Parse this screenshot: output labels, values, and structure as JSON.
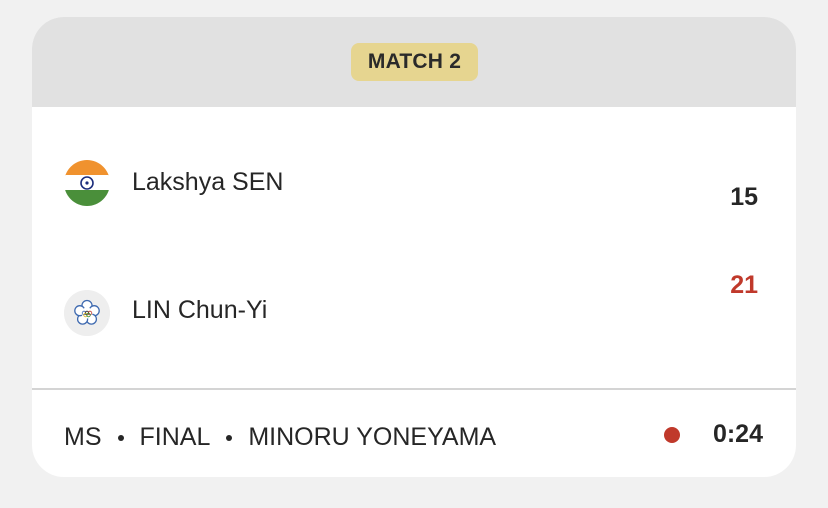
{
  "match": {
    "badge_label": "MATCH 2"
  },
  "players": [
    {
      "name": "Lakshya SEN",
      "score": "15",
      "flag_icon": "india-flag-icon"
    },
    {
      "name": "LIN Chun-Yi",
      "score": "21",
      "flag_icon": "chinese-taipei-flag-icon"
    }
  ],
  "footer": {
    "event": "MS",
    "round": "FINAL",
    "court": "MINORU YONEYAMA",
    "time": "0:24",
    "live_indicator_color": "#c0392b"
  },
  "colors": {
    "badge_bg": "#e6d590",
    "header_bg": "#e1e1e1",
    "winner_score": "#c0392b"
  }
}
